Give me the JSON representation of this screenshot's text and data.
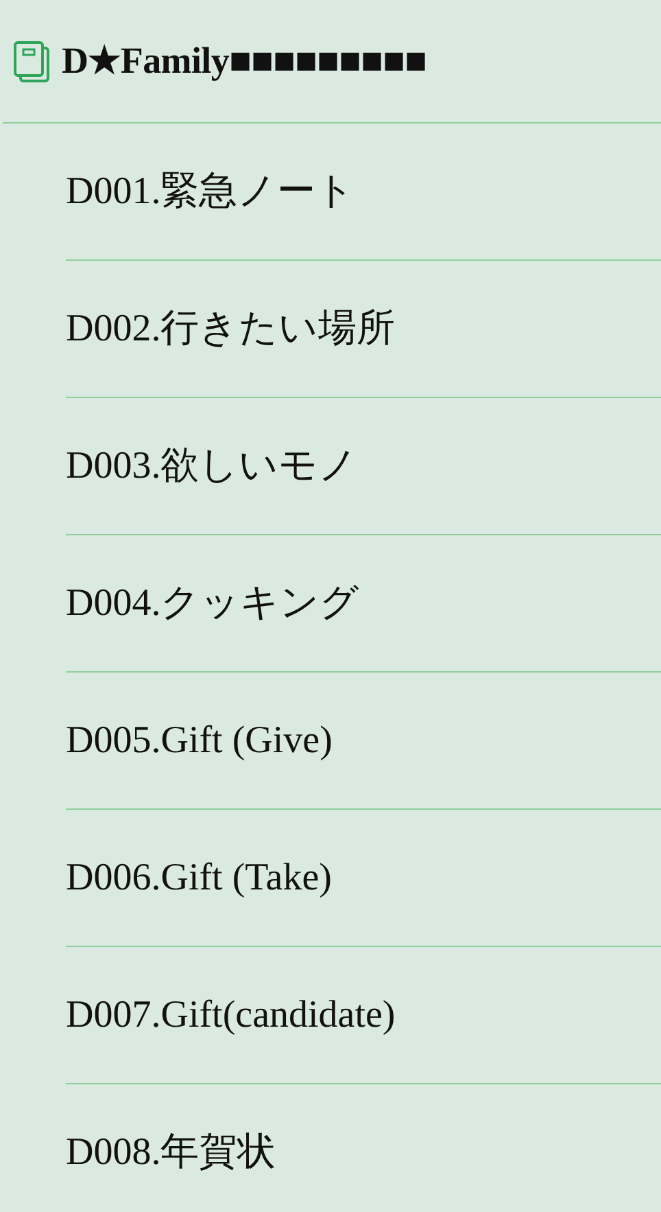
{
  "header": {
    "title": "D★Family■■■■■■■■■"
  },
  "items": [
    {
      "label": "D001.緊急ノート"
    },
    {
      "label": "D002.行きたい場所"
    },
    {
      "label": "D003.欲しいモノ"
    },
    {
      "label": "D004.クッキング"
    },
    {
      "label": "D005.Gift (Give)"
    },
    {
      "label": "D006.Gift (Take)"
    },
    {
      "label": "D007.Gift(candidate)"
    },
    {
      "label": "D008.年賀状"
    }
  ]
}
